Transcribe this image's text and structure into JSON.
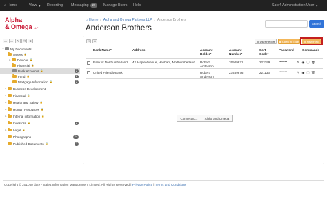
{
  "nav": {
    "home": "Home",
    "view": "View",
    "reporting": "Reporting",
    "messaging": "Messaging",
    "messaging_count": "29",
    "manage_users": "Manage Users",
    "help": "Help",
    "user": "Safe4 Administration User"
  },
  "logo": {
    "line1": "Alpha",
    "line2": "& Omega",
    "suffix": "LLP"
  },
  "breadcrumb": {
    "home": "Home",
    "company": "Alpha and Omega Partners LLP",
    "current": "Anderson Brothers"
  },
  "page_title": "Anderson Brothers",
  "search": {
    "placeholder": "",
    "button": "Search"
  },
  "sidebar": {
    "items": [
      {
        "label": "My Documents"
      },
      {
        "label": "Assets"
      },
      {
        "label": "Devices"
      },
      {
        "label": "Financial"
      },
      {
        "label": "Bank Accounts",
        "count": "2"
      },
      {
        "label": "Fund",
        "count": "2"
      },
      {
        "label": "Mortgage Information",
        "count": "2"
      },
      {
        "label": "Business Development"
      },
      {
        "label": "Financial"
      },
      {
        "label": "Health and Safety"
      },
      {
        "label": "Human Resources"
      },
      {
        "label": "Internal information"
      },
      {
        "label": "Investors",
        "count": "2"
      },
      {
        "label": "Legal"
      },
      {
        "label": "Photographs",
        "count": "24"
      },
      {
        "label": "Published Documents",
        "count": "2"
      }
    ]
  },
  "toolbar": {
    "user_report": "User Report",
    "open_excel": "Open in Excel",
    "new_field": "New Field"
  },
  "table": {
    "headers": {
      "bank_name": "Bank Name*",
      "address": "Address",
      "holder": "Account Holder*",
      "number": "Account Number*",
      "sort": "Sort Code*",
      "password": "Password",
      "commands": "Commands"
    },
    "rows": [
      {
        "bank_name": "Bank of Northumberland",
        "address": "42 Maple Avenue, Hexham, Northumberland",
        "holder": "Robert Anderson",
        "number": "76509821",
        "sort": "223399",
        "password": "••••••"
      },
      {
        "bank_name": "United Friendly Bank",
        "address": "",
        "holder": "Robert Anderson",
        "number": "23459876",
        "sort": "221133",
        "password": "••••••"
      }
    ]
  },
  "connect": {
    "label": "Connect to...",
    "target": "Alpha and Omega"
  },
  "footer": {
    "text": "Copyright © 2010 to date - Safe4 Information Management Limited, All Rights Reserved |",
    "privacy": "Privacy Policy",
    "separator": "|",
    "terms": "Terms and Conditions"
  }
}
